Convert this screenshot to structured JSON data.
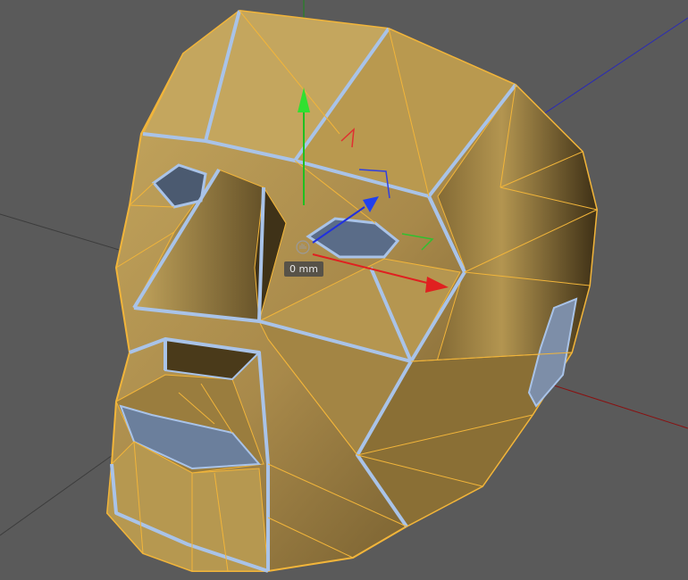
{
  "viewport": {
    "measure_readout": "0 mm",
    "background_color": "#5a5a5a"
  },
  "colors": {
    "mesh_fill": "#b89a55",
    "mesh_fill_dark": "#7a6230",
    "edge_orange": "#f2b53a",
    "edge_blue": "#a9c3e8",
    "axis_x": "#e02020",
    "axis_y": "#20c020",
    "axis_z": "#2030e0",
    "world_axis_x": "#8a1010",
    "world_axis_y": "#108a10",
    "world_axis_z": "#2020b0",
    "world_axis_neutral": "#3a3a3a"
  },
  "icons": {
    "move_gizmo": "move-gizmo-icon",
    "cursor_handle": "hand-cursor-icon"
  }
}
